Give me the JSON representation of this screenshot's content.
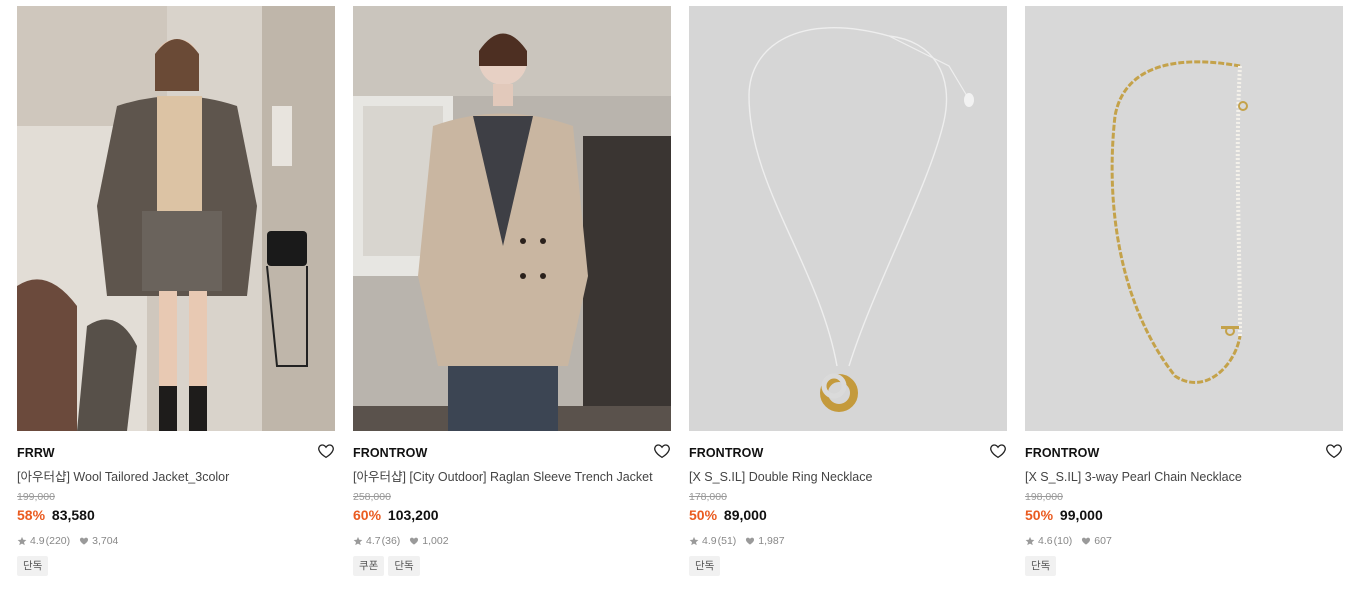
{
  "products": [
    {
      "brand": "FRRW",
      "name": "[아우터샵] Wool Tailored Jacket_3color",
      "original_price": "199,000",
      "discount": "58%",
      "price": "83,580",
      "rating": "4.9",
      "reviews": "(220)",
      "likes": "3,704",
      "tags": [
        "단독"
      ]
    },
    {
      "brand": "FRONTROW",
      "name": "[아우터샵] [City Outdoor] Raglan Sleeve Trench Jacket",
      "original_price": "258,000",
      "discount": "60%",
      "price": "103,200",
      "rating": "4.7",
      "reviews": "(36)",
      "likes": "1,002",
      "tags": [
        "쿠폰",
        "단독"
      ]
    },
    {
      "brand": "FRONTROW",
      "name": "[X S_S.IL] Double Ring Necklace",
      "original_price": "178,000",
      "discount": "50%",
      "price": "89,000",
      "rating": "4.9",
      "reviews": "(51)",
      "likes": "1,987",
      "tags": [
        "단독"
      ]
    },
    {
      "brand": "FRONTROW",
      "name": "[X S_S.IL] 3-way Pearl Chain Necklace",
      "original_price": "198,000",
      "discount": "50%",
      "price": "99,000",
      "rating": "4.6",
      "reviews": "(10)",
      "likes": "607",
      "tags": [
        "단독"
      ]
    }
  ],
  "colors": {
    "discount": "#ea5b20",
    "muted": "#888888",
    "tag_bg": "#f1f1f1"
  },
  "icons": {
    "like": "heart-outline-icon",
    "rating": "star-icon",
    "likes_count": "heart-filled-icon"
  }
}
